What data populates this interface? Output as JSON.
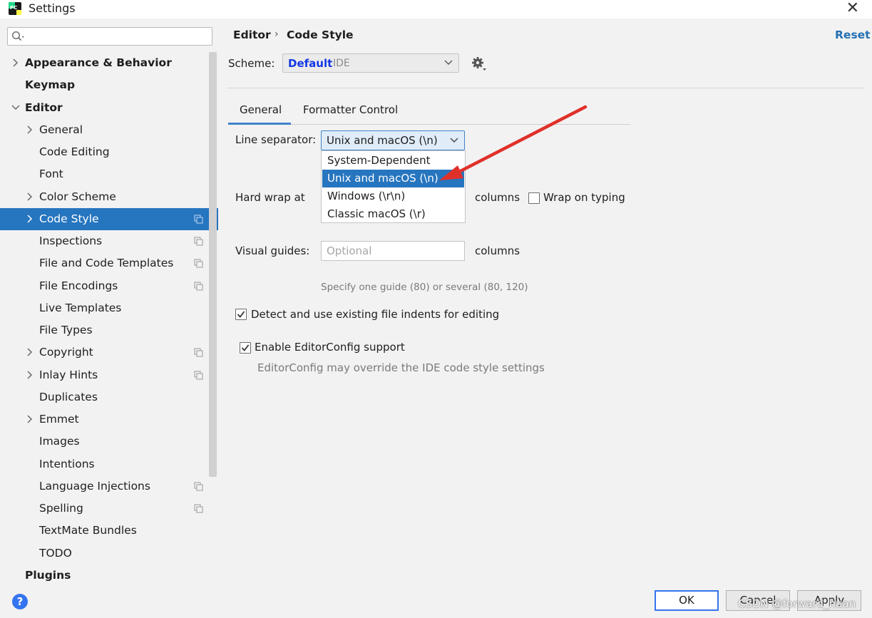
{
  "window": {
    "title": "Settings",
    "app_icon_text": "PC"
  },
  "search": {
    "placeholder": "",
    "value": ""
  },
  "sidebar": {
    "items": [
      {
        "label": "Appearance & Behavior",
        "level": 0,
        "bold": true,
        "expandable": true,
        "expanded": false
      },
      {
        "label": "Keymap",
        "level": 0,
        "bold": true,
        "expandable": false
      },
      {
        "label": "Editor",
        "level": 0,
        "bold": true,
        "expandable": true,
        "expanded": true
      },
      {
        "label": "General",
        "level": 1,
        "expandable": true,
        "expanded": false
      },
      {
        "label": "Code Editing",
        "level": 1
      },
      {
        "label": "Font",
        "level": 1
      },
      {
        "label": "Color Scheme",
        "level": 1,
        "expandable": true,
        "expanded": false
      },
      {
        "label": "Code Style",
        "level": 1,
        "expandable": true,
        "expanded": false,
        "selected": true,
        "project_icon": true
      },
      {
        "label": "Inspections",
        "level": 1,
        "project_icon": true
      },
      {
        "label": "File and Code Templates",
        "level": 1,
        "project_icon": true
      },
      {
        "label": "File Encodings",
        "level": 1,
        "project_icon": true
      },
      {
        "label": "Live Templates",
        "level": 1
      },
      {
        "label": "File Types",
        "level": 1
      },
      {
        "label": "Copyright",
        "level": 1,
        "expandable": true,
        "expanded": false,
        "project_icon": true
      },
      {
        "label": "Inlay Hints",
        "level": 1,
        "expandable": true,
        "expanded": false,
        "project_icon": true
      },
      {
        "label": "Duplicates",
        "level": 1
      },
      {
        "label": "Emmet",
        "level": 1,
        "expandable": true,
        "expanded": false
      },
      {
        "label": "Images",
        "level": 1
      },
      {
        "label": "Intentions",
        "level": 1
      },
      {
        "label": "Language Injections",
        "level": 1,
        "project_icon": true
      },
      {
        "label": "Spelling",
        "level": 1,
        "project_icon": true
      },
      {
        "label": "TextMate Bundles",
        "level": 1
      },
      {
        "label": "TODO",
        "level": 1
      },
      {
        "label": "Plugins",
        "level": 0,
        "bold": true
      }
    ]
  },
  "header": {
    "breadcrumb": [
      "Editor",
      "Code Style"
    ],
    "breadcrumb_separator": "›",
    "reset_label": "Reset"
  },
  "scheme": {
    "label": "Scheme:",
    "value_name": "Default",
    "value_type": "IDE"
  },
  "tabs": [
    {
      "label": "General",
      "active": true
    },
    {
      "label": "Formatter Control",
      "active": false
    }
  ],
  "general": {
    "line_separator": {
      "label": "Line separator:",
      "value": "Unix and macOS (\\n)",
      "options": [
        "System-Dependent",
        "Unix and macOS (\\n)",
        "Windows (\\r\\n)",
        "Classic macOS (\\r)"
      ],
      "highlighted_index": 1
    },
    "hard_wrap": {
      "label": "Hard wrap at",
      "value": "",
      "unit": "columns",
      "wrap_on_typing_label": "Wrap on typing",
      "wrap_on_typing_checked": false
    },
    "visual_guides": {
      "label": "Visual guides:",
      "placeholder": "Optional",
      "unit": "columns",
      "hint": "Specify one guide (80) or several (80, 120)"
    },
    "detect_indents": {
      "label": "Detect and use existing file indents for editing",
      "checked": true
    },
    "editorconfig": {
      "label": "Enable EditorConfig support",
      "checked": true,
      "hint": "EditorConfig may override the IDE code style settings"
    }
  },
  "footer": {
    "help_label": "?",
    "ok_label": "OK",
    "cancel_label": "Cancel",
    "apply_label": "Apply",
    "watermark": "CSDN @forward_huan"
  },
  "colors": {
    "selection": "#2675bf",
    "link": "#2470b3",
    "scheme_name": "#1437e6",
    "annotation_arrow": "#e0302a"
  }
}
